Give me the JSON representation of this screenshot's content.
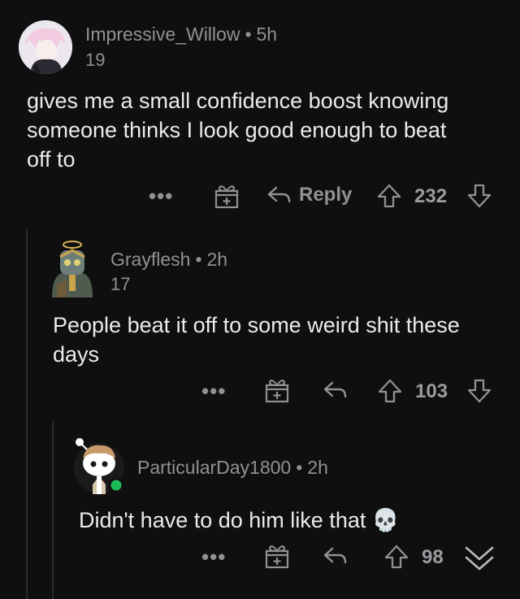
{
  "comments": [
    {
      "username": "Impressive_Willow",
      "time": "5h",
      "karma": "19",
      "body": "gives me a small confidence boost knowing someone thinks I look good enough to beat off to",
      "reply_label": "Reply",
      "votes": "232"
    },
    {
      "username": "Grayflesh",
      "time": "2h",
      "karma": "17",
      "body": "People beat it off to some weird shit these days",
      "votes": "103"
    },
    {
      "username": "ParticularDay1800",
      "time": "2h",
      "body": "Didn't have to do him like that",
      "emoji": "💀",
      "votes": "98"
    }
  ],
  "separator": "•",
  "more_label": "•••",
  "colors": {
    "background": "#0f0f10",
    "text": "#e9ebed",
    "muted": "#8f9194",
    "thread_line": "#2a2b2d",
    "online": "#1db954"
  }
}
